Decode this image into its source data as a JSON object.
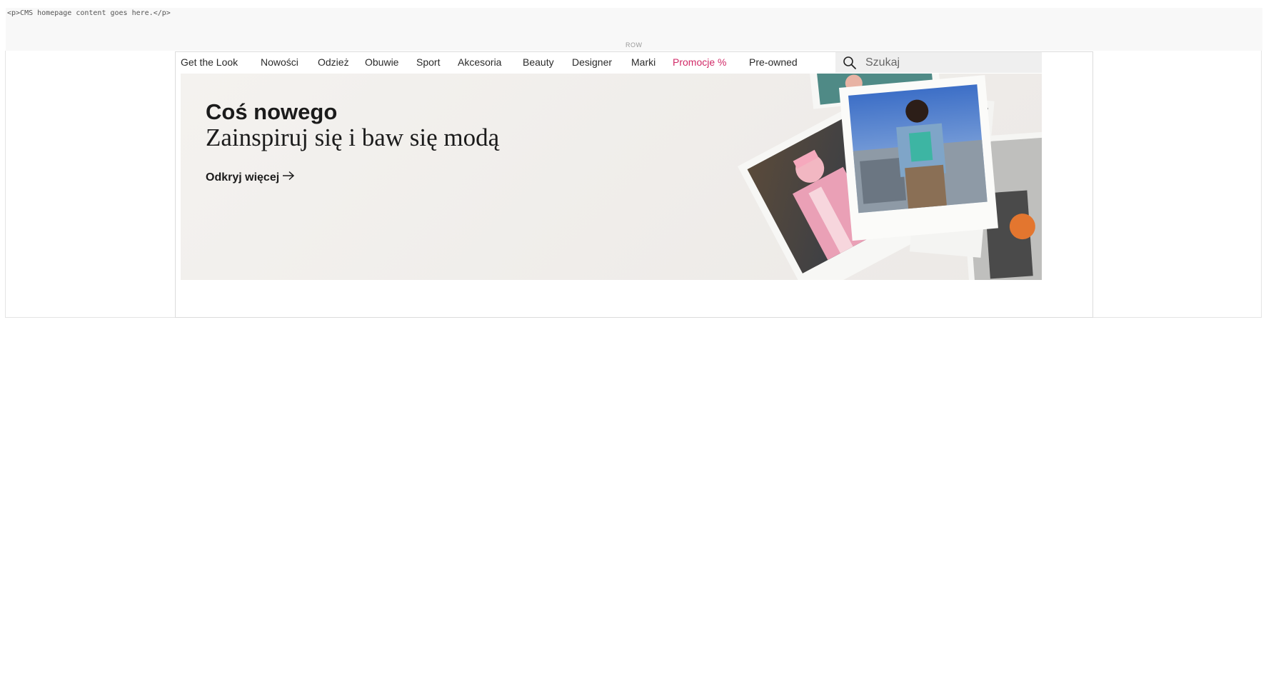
{
  "cms": {
    "placeholder_html": "<p>CMS homepage content goes here.</p>"
  },
  "row": {
    "label": "ROW"
  },
  "nav": {
    "items": [
      {
        "label": "Get the Look"
      },
      {
        "label": "Nowości"
      },
      {
        "label": "Odzież"
      },
      {
        "label": "Obuwie"
      },
      {
        "label": "Sport"
      },
      {
        "label": "Akcesoria"
      },
      {
        "label": "Beauty"
      },
      {
        "label": "Designer"
      },
      {
        "label": "Marki"
      },
      {
        "label": "Promocje %"
      },
      {
        "label": "Pre-owned"
      }
    ],
    "promo_color": "#d12a67"
  },
  "search": {
    "placeholder": "Szukaj",
    "icon": "search-icon"
  },
  "hero": {
    "title": "Coś nowego",
    "subtitle": "Zainspiruj się i baw się modą",
    "cta_label": "Odkryj więcej",
    "cta_icon": "arrow-right-icon"
  }
}
